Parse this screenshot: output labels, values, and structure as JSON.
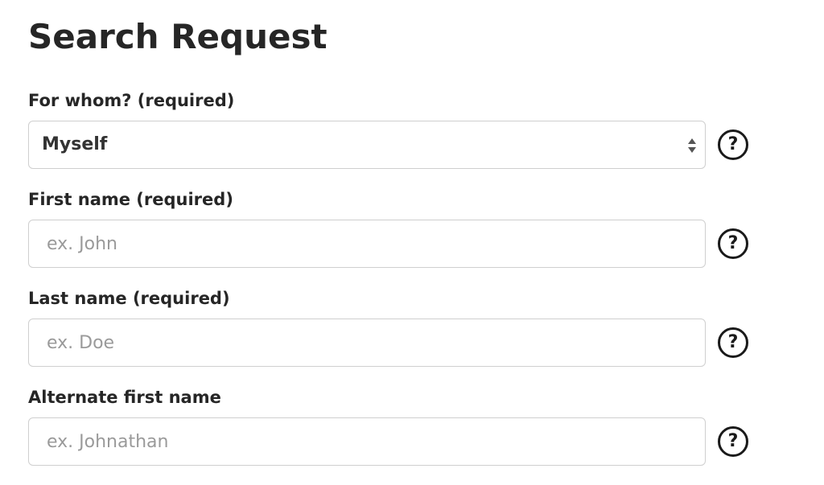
{
  "page": {
    "title": "Search Request"
  },
  "fields": {
    "for_whom": {
      "label": "For whom? (required)",
      "selected_value": "Myself",
      "help_text": "?"
    },
    "first_name": {
      "label": "First name (required)",
      "placeholder": "ex. John",
      "value": "",
      "help_text": "?"
    },
    "last_name": {
      "label": "Last name (required)",
      "placeholder": "ex. Doe",
      "value": "",
      "help_text": "?"
    },
    "alternate_first_name": {
      "label": "Alternate first name",
      "placeholder": "ex. Johnathan",
      "value": "",
      "help_text": "?"
    }
  },
  "icons": {
    "help": "question-circle-icon",
    "select_arrows": "sort-arrows-icon"
  },
  "colors": {
    "text": "#262626",
    "placeholder": "#9a9a9a",
    "border": "#cfcfcf",
    "icon": "#1a1a1a"
  }
}
